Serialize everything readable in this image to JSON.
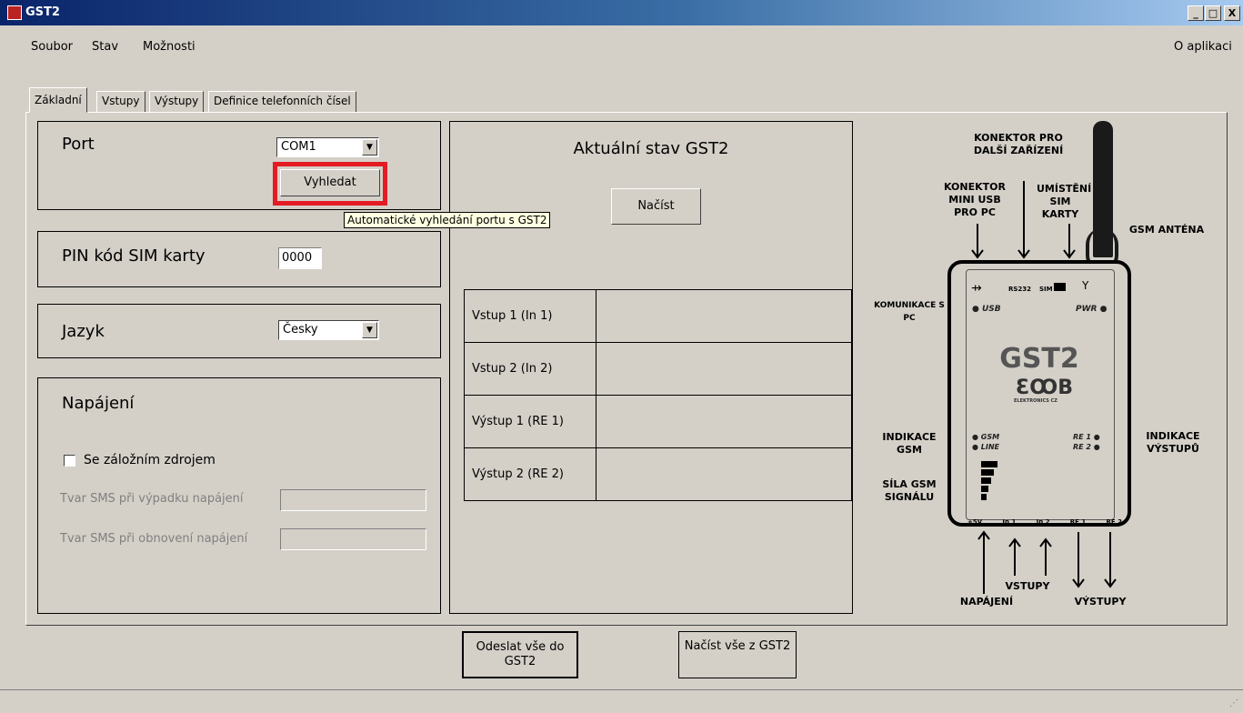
{
  "window": {
    "title": "GST2",
    "minimize": "_",
    "maximize": "□",
    "close": "X"
  },
  "menu": {
    "items": [
      "Soubor",
      "Stav",
      "Možnosti"
    ],
    "right": "O aplikaci"
  },
  "tabs": [
    "Základní",
    "Vstupy",
    "Výstupy",
    "Definice telefonních čísel"
  ],
  "port": {
    "label": "Port",
    "value": "COM1",
    "search_button": "Vyhledat",
    "tooltip": "Automatické vyhledání portu s GST2"
  },
  "pin": {
    "label": "PIN kód SIM karty",
    "value": "0000"
  },
  "language": {
    "label": "Jazyk",
    "value": "Česky"
  },
  "power": {
    "label": "Napájení",
    "backup_checkbox": "Se záložním zdrojem",
    "backup_checked": false,
    "sms_fail_label": "Tvar SMS při výpadku napájení",
    "sms_restore_label": "Tvar SMS při obnovení napájení"
  },
  "status": {
    "title": "Aktuální stav GST2",
    "load_button": "Načíst",
    "rows": [
      "Vstup 1 (In 1)",
      "Vstup 2 (In 2)",
      "Výstup 1 (RE 1)",
      "Výstup 2 (RE 2)"
    ]
  },
  "device": {
    "name": "GST2",
    "labels": {
      "connector": "KONEKTOR PRO DALŠÍ ZAŘÍZENÍ",
      "mini_usb": "KONEKTOR MINI USB PRO PC",
      "sim": "UMÍSTĚNÍ SIM KARTY",
      "antenna": "GSM ANTÉNA",
      "pc_comm": "KOMUNIKACE S PC",
      "gsm_ind": "INDIKACE GSM",
      "signal": "SÍLA GSM SIGNÁLU",
      "outputs_ind": "INDIKACE VÝSTUPŮ",
      "power": "NAPÁJENÍ",
      "inputs": "VSTUPY",
      "outputs": "VÝSTUPY"
    },
    "leds": {
      "usb": "USB",
      "pwr": "PWR",
      "gsm": "GSM",
      "line": "LINE",
      "re1": "RE 1",
      "re2": "RE 2"
    },
    "top_ports": {
      "rs232": "RS232",
      "sim": "SIM"
    },
    "bottom_ports": [
      "+5V",
      "In 1",
      "In 2",
      "RE 1",
      "RE 2"
    ],
    "brand": "ELEKTRONICS CZ"
  },
  "footer": {
    "send_all": "Odeslat vše do GST2",
    "load_all": "Načíst vše z GST2"
  }
}
